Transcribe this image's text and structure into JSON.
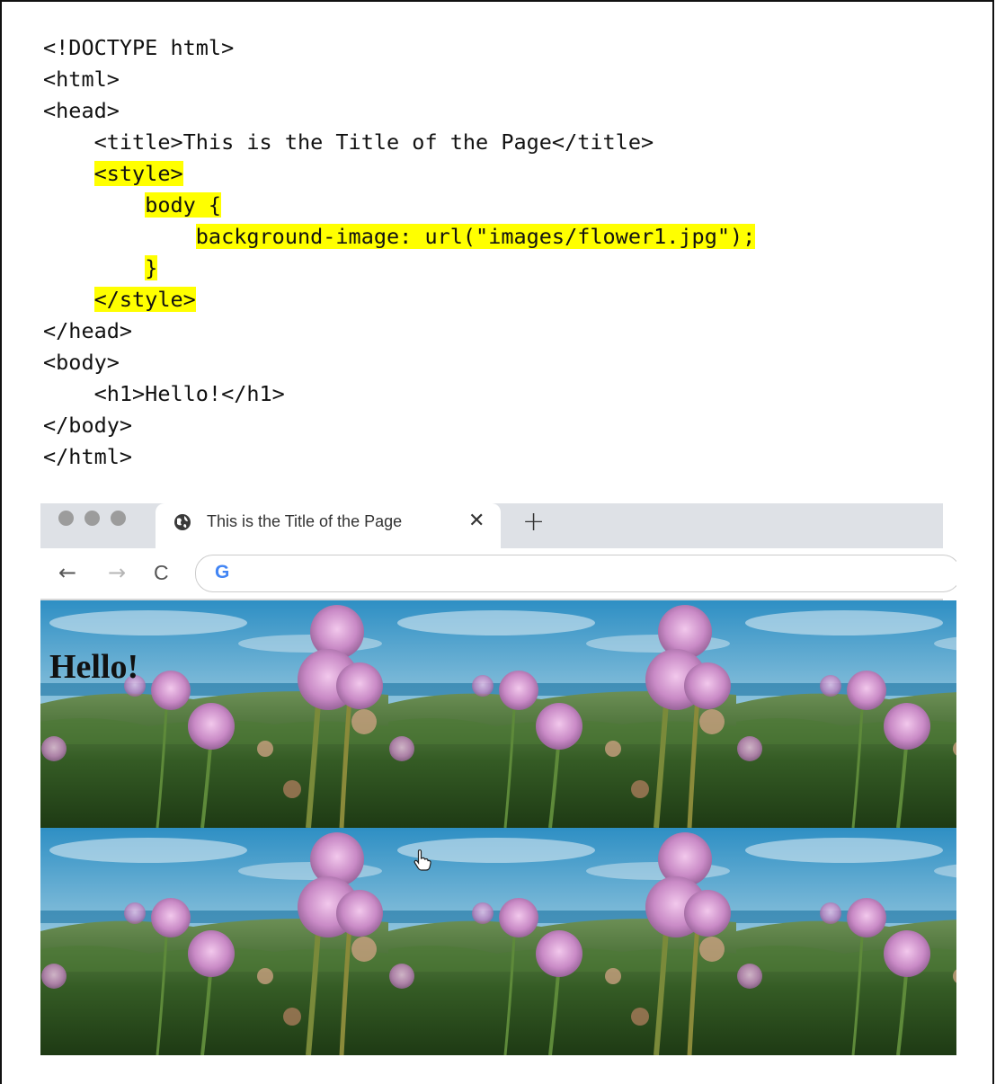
{
  "code": {
    "lines": [
      {
        "text": "<!DOCTYPE html>",
        "indent": "",
        "highlight": false
      },
      {
        "text": "<html>",
        "indent": "",
        "highlight": false
      },
      {
        "text": "<head>",
        "indent": "",
        "highlight": false
      },
      {
        "text": "<title>This is the Title of the Page</title>",
        "indent": "    ",
        "highlight": false
      },
      {
        "text": "<style>",
        "indent": "    ",
        "highlight": true
      },
      {
        "text": "body {",
        "indent": "        ",
        "highlight": true
      },
      {
        "text": "background-image: url(\"images/flower1.jpg\");",
        "indent": "            ",
        "highlight": true
      },
      {
        "text": "}",
        "indent": "        ",
        "highlight": true
      },
      {
        "text": "</style>",
        "indent": "    ",
        "highlight": true
      },
      {
        "text": "</head>",
        "indent": "",
        "highlight": false
      },
      {
        "text": "<body>",
        "indent": "",
        "highlight": false
      },
      {
        "text": "<h1>Hello!</h1>",
        "indent": "    ",
        "highlight": false
      },
      {
        "text": "</body>",
        "indent": "",
        "highlight": false
      },
      {
        "text": "</html>",
        "indent": "",
        "highlight": false
      }
    ],
    "highlight_color": "#ffff00"
  },
  "browser": {
    "tab": {
      "title": "This is the Title of the Page",
      "icon": "globe-icon",
      "close": "✕"
    },
    "new_tab": "+",
    "nav": {
      "back": "←",
      "forward": "→",
      "reload": "C"
    },
    "omnibox": {
      "logo": "G"
    }
  },
  "page": {
    "heading": "Hello!"
  }
}
